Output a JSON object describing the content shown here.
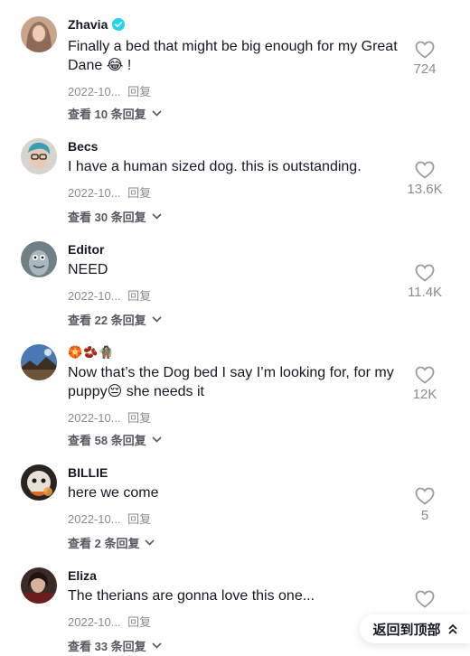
{
  "comments": [
    {
      "username": "Zhavia",
      "verified": true,
      "text": "Finally a bed that might be big enough for my Great Dane 😂 !",
      "date": "2022-10...",
      "reply_label": "回复",
      "view_replies": "查看 10 条回复",
      "likes": "724"
    },
    {
      "username": "Becs",
      "text": "I have a human sized dog. this is outstanding.",
      "date": "2022-10...",
      "reply_label": "回复",
      "view_replies": "查看 30 条回复",
      "likes": "13.6K"
    },
    {
      "username": "Editor",
      "text": "NEED",
      "date": "2022-10...",
      "reply_label": "回复",
      "view_replies": "查看 22 条回复",
      "likes": "11.4K"
    },
    {
      "username": "🏵️🫘🧌",
      "text": "Now that’s the Dog bed I say I’m looking for, for my puppy😔 she needs it",
      "date": "2022-10...",
      "reply_label": "回复",
      "view_replies": "查看 58 条回复",
      "likes": "12K"
    },
    {
      "username": "BILLIE",
      "text": "here we come",
      "date": "2022-10...",
      "reply_label": "回复",
      "view_replies": "查看 2 条回复",
      "likes": "5"
    },
    {
      "username": "Eliza",
      "text": "The therians are gonna love this one...",
      "date": "2022-10...",
      "reply_label": "回复",
      "view_replies": "查看 33 条回复",
      "likes": ""
    }
  ],
  "back_to_top": "返回到顶部",
  "icons": {
    "like": "heart-outline-icon",
    "expand": "chevron-down-icon",
    "back_to_top": "double-chevron-up-icon",
    "verified": "verified-badge-icon"
  },
  "colors": {
    "text": "#161823",
    "muted": "#8a8b91",
    "verified": "#20d5ec"
  }
}
